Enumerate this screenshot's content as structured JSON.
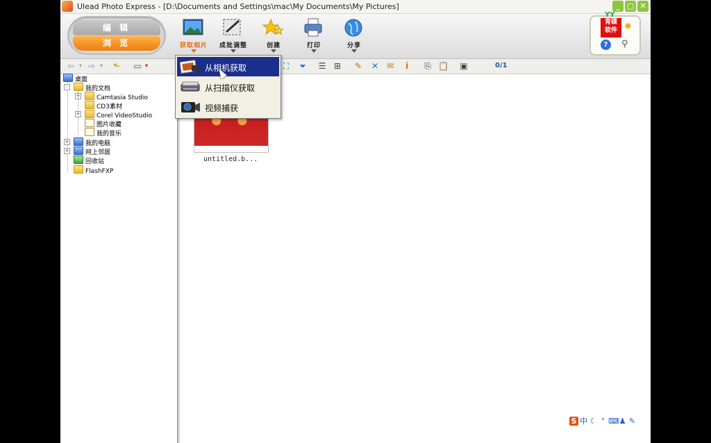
{
  "window": {
    "title": "Ulead Photo Express - [D:\\Documents and Settings\\mac\\My Documents\\My Pictures]",
    "controls": [
      "minimize",
      "maximize",
      "close"
    ]
  },
  "mode": {
    "edit_label": "编 辑",
    "browse_label": "浏 览"
  },
  "toolbar": {
    "buttons": [
      {
        "label": "获取相片",
        "icon": "landscape-photo-icon"
      },
      {
        "label": "成批调整",
        "icon": "batch-adjust-icon"
      },
      {
        "label": "创建",
        "icon": "create-star-icon"
      },
      {
        "label": "打印",
        "icon": "printer-icon"
      },
      {
        "label": "分享",
        "icon": "globe-share-icon"
      }
    ]
  },
  "logo": {
    "line1": "育碟",
    "line2": "软件",
    "top_text": "YY"
  },
  "subtoolbar": {
    "counter": "0/1"
  },
  "tree": {
    "root": "桌面",
    "items": [
      {
        "label": "我的文档",
        "level": 1,
        "expander": "-"
      },
      {
        "label": "Camtasia Studio",
        "level": 2,
        "expander": "+"
      },
      {
        "label": "CD3素材",
        "level": 2,
        "expander": ""
      },
      {
        "label": "Corel VideoStudio",
        "level": 2,
        "expander": "+"
      },
      {
        "label": "图片收藏",
        "level": 2,
        "expander": ""
      },
      {
        "label": "我的音乐",
        "level": 2,
        "expander": ""
      },
      {
        "label": "我的电脑",
        "level": 1,
        "expander": "+"
      },
      {
        "label": "网上邻居",
        "level": 1,
        "expander": "+"
      },
      {
        "label": "回收站",
        "level": 1,
        "expander": ""
      },
      {
        "label": "FlashFXP",
        "level": 1,
        "expander": ""
      }
    ]
  },
  "content": {
    "thumbnail_caption": "untitled.b..."
  },
  "dropdown": {
    "items": [
      {
        "label": "从相机获取",
        "selected": true
      },
      {
        "label": "从扫描仪获取",
        "selected": false
      },
      {
        "label": "视频捕获",
        "selected": false
      }
    ]
  },
  "tray": {
    "ime_label": "中"
  }
}
